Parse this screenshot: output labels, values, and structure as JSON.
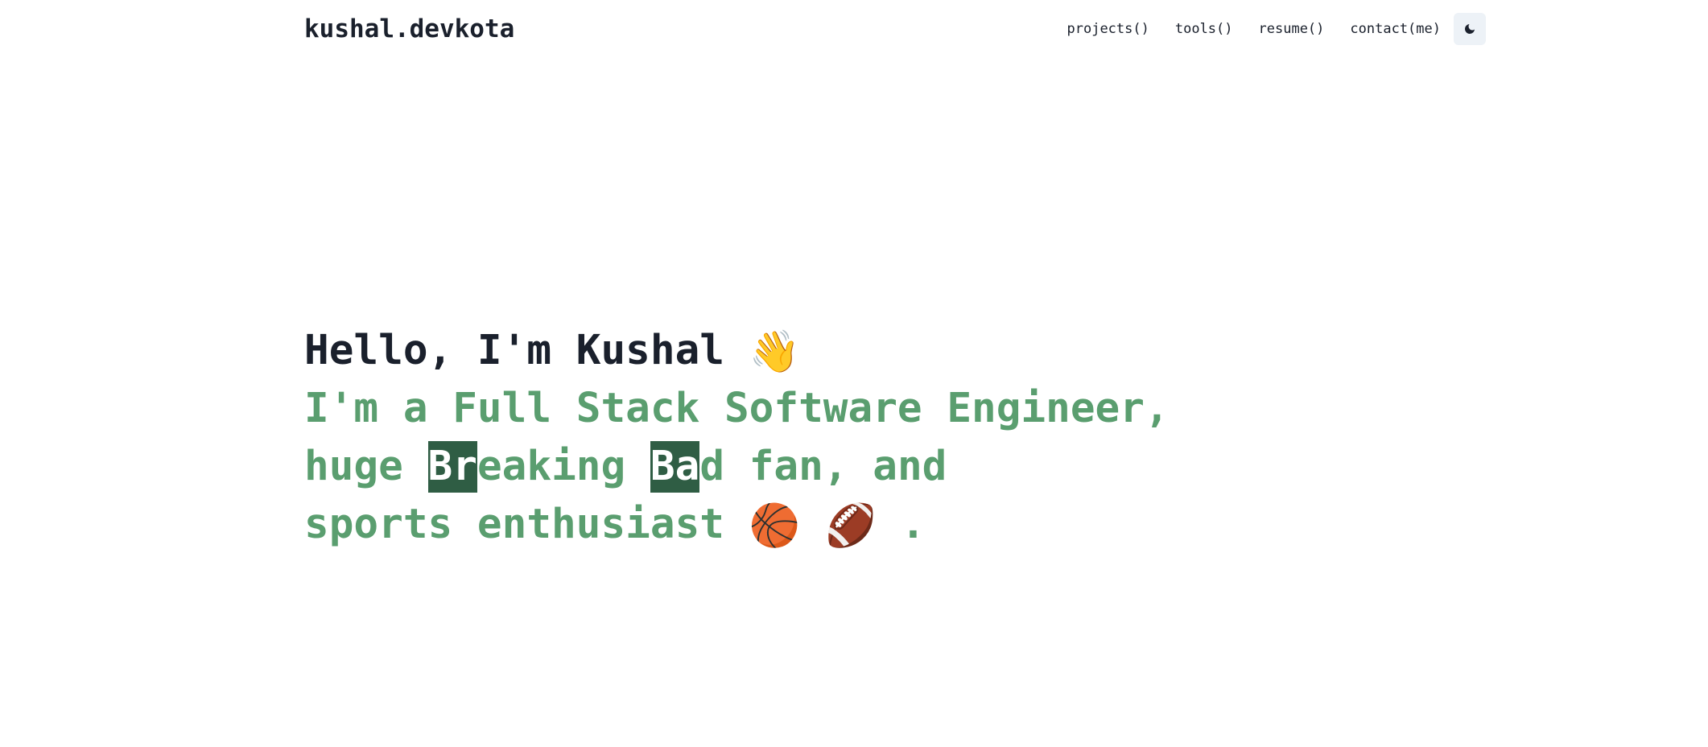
{
  "header": {
    "logo": "kushal.devkota",
    "nav": [
      {
        "label": "projects()"
      },
      {
        "label": "tools()"
      },
      {
        "label": "resume()"
      },
      {
        "label": "contact(me)"
      }
    ],
    "theme_toggle_icon": "moon-icon"
  },
  "hero": {
    "greeting": "Hello, I'm Kushal",
    "greeting_emoji": "👋",
    "line1": "I'm a Full Stack Software Engineer,",
    "line2_prefix": "huge ",
    "line2_hl1": "Br",
    "line2_mid": "eaking ",
    "line2_hl2": "Ba",
    "line2_suffix": "d fan, and",
    "line3_prefix": "sports enthusiast",
    "emoji_basketball": "🏀",
    "emoji_football": "🏈",
    "line3_suffix": "."
  },
  "colors": {
    "accent_green": "#5a9e6f",
    "highlight_green": "#2f5d44",
    "text_dark": "#1a202c",
    "toggle_bg": "#edf2f7"
  }
}
